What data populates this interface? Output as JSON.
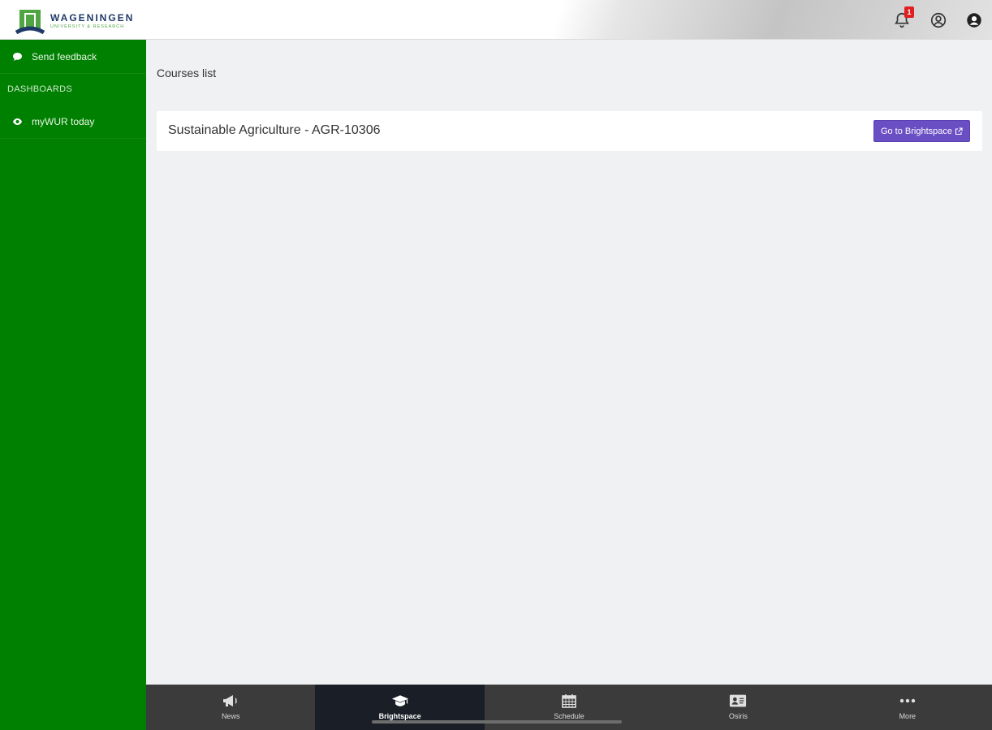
{
  "header": {
    "logo": {
      "title": "WAGENINGEN",
      "subtitle": "UNIVERSITY & RESEARCH"
    },
    "icons": [
      {
        "name": "bell-icon",
        "badge": "1"
      },
      {
        "name": "user-circle-icon"
      },
      {
        "name": "account-icon"
      }
    ]
  },
  "sidebar": {
    "items": [
      {
        "label": "Send feedback",
        "icon": "comment-icon"
      }
    ],
    "section_title": "DASHBOARDS",
    "dashboard_items": [
      {
        "label": "myWUR today",
        "icon": "eye-icon"
      }
    ]
  },
  "main": {
    "page_title": "Courses list",
    "courses": [
      {
        "name": "Sustainable Agriculture - AGR-10306",
        "button_label": "Go to Brightspace"
      }
    ]
  },
  "tabbar": {
    "tabs": [
      {
        "label": "News",
        "icon": "megaphone-icon",
        "active": false
      },
      {
        "label": "Brightspace",
        "icon": "graduation-cap-icon",
        "active": true
      },
      {
        "label": "Schedule",
        "icon": "calendar-icon",
        "active": false
      },
      {
        "label": "Osiris",
        "icon": "id-card-icon",
        "active": false
      },
      {
        "label": "More",
        "icon": "ellipsis-icon",
        "active": false
      }
    ]
  },
  "colors": {
    "sidebar": "#008000",
    "button": "#6a4fc4",
    "tabbar": "#3b3b3b",
    "tab_active": "#1a1e26",
    "badge": "#e02020"
  }
}
